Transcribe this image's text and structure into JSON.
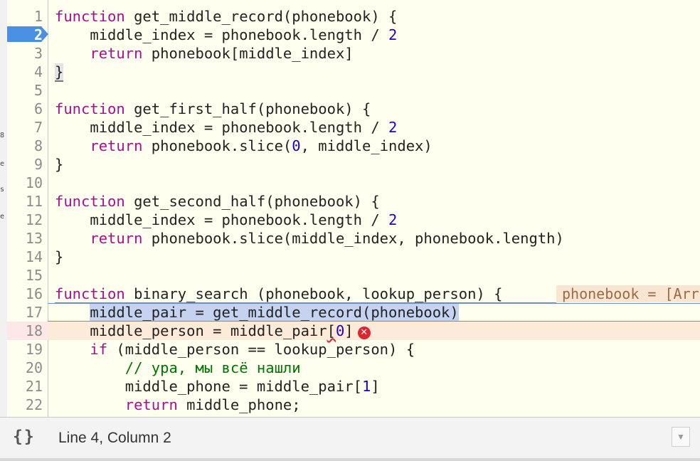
{
  "editor": {
    "breakpoint_line": 2,
    "paused_line": 17,
    "error_line": 18,
    "inline_value": "phonebook = [Arr",
    "error_icon": "error-circle-icon",
    "lines": [
      {
        "n": "1",
        "segs": [
          [
            "kw",
            "function"
          ],
          [
            "t",
            " get_middle_record(phonebook) "
          ],
          [
            "br",
            "{"
          ]
        ]
      },
      {
        "n": "2",
        "segs": [
          [
            "t",
            "    middle_index = phonebook.length / "
          ],
          [
            "num",
            "2"
          ]
        ]
      },
      {
        "n": "3",
        "segs": [
          [
            "t",
            "    "
          ],
          [
            "kw",
            "return"
          ],
          [
            "t",
            " phonebook[middle_index]"
          ]
        ]
      },
      {
        "n": "4",
        "segs": [
          [
            "br",
            "}"
          ]
        ]
      },
      {
        "n": "5",
        "segs": []
      },
      {
        "n": "6",
        "segs": [
          [
            "kw",
            "function"
          ],
          [
            "t",
            " get_first_half(phonebook) {"
          ]
        ]
      },
      {
        "n": "7",
        "segs": [
          [
            "t",
            "    middle_index = phonebook.length / "
          ],
          [
            "num",
            "2"
          ]
        ]
      },
      {
        "n": "8",
        "segs": [
          [
            "t",
            "    "
          ],
          [
            "kw",
            "return"
          ],
          [
            "t",
            " phonebook.slice("
          ],
          [
            "num",
            "0"
          ],
          [
            "t",
            ", middle_index)"
          ]
        ]
      },
      {
        "n": "9",
        "segs": [
          [
            "t",
            "}"
          ]
        ]
      },
      {
        "n": "10",
        "segs": []
      },
      {
        "n": "11",
        "segs": [
          [
            "kw",
            "function"
          ],
          [
            "t",
            " get_second_half(phonebook) {"
          ]
        ]
      },
      {
        "n": "12",
        "segs": [
          [
            "t",
            "    middle_index = phonebook.length / "
          ],
          [
            "num",
            "2"
          ]
        ]
      },
      {
        "n": "13",
        "segs": [
          [
            "t",
            "    "
          ],
          [
            "kw",
            "return"
          ],
          [
            "t",
            " phonebook.slice(middle_index, phonebook.length)"
          ]
        ]
      },
      {
        "n": "14",
        "segs": [
          [
            "t",
            "}"
          ]
        ]
      },
      {
        "n": "15",
        "segs": []
      },
      {
        "n": "16",
        "segs": [
          [
            "kw",
            "function"
          ],
          [
            "t",
            " binary_search (phonebook, lookup_person) {"
          ]
        ]
      },
      {
        "n": "17",
        "segs": [
          [
            "t",
            "    "
          ],
          [
            "sel",
            "middle_pair = get_middle_record(phonebook)"
          ]
        ]
      },
      {
        "n": "18",
        "segs": [
          [
            "t",
            "    middle_person = middle_pair"
          ],
          [
            "sq",
            "["
          ],
          [
            "num",
            "0"
          ],
          [
            "t",
            "]"
          ]
        ]
      },
      {
        "n": "19",
        "segs": [
          [
            "t",
            "    "
          ],
          [
            "kw",
            "if"
          ],
          [
            "t",
            " (middle_person == lookup_person) {"
          ]
        ]
      },
      {
        "n": "20",
        "segs": [
          [
            "t",
            "        "
          ],
          [
            "cm",
            "// ура, мы всё нашли"
          ]
        ]
      },
      {
        "n": "21",
        "segs": [
          [
            "t",
            "        middle_phone = middle_pair["
          ],
          [
            "num",
            "1"
          ],
          [
            "t",
            "]"
          ]
        ]
      },
      {
        "n": "22",
        "segs": [
          [
            "t",
            "        "
          ],
          [
            "kw",
            "return"
          ],
          [
            "t",
            " middle_phone;"
          ]
        ]
      }
    ]
  },
  "status_bar": {
    "pretty_print_label": "{}",
    "pretty_print_icon": "curly-braces-icon",
    "position": "Line 4, Column 2",
    "dropdown_icon": "chevron-down-icon"
  }
}
